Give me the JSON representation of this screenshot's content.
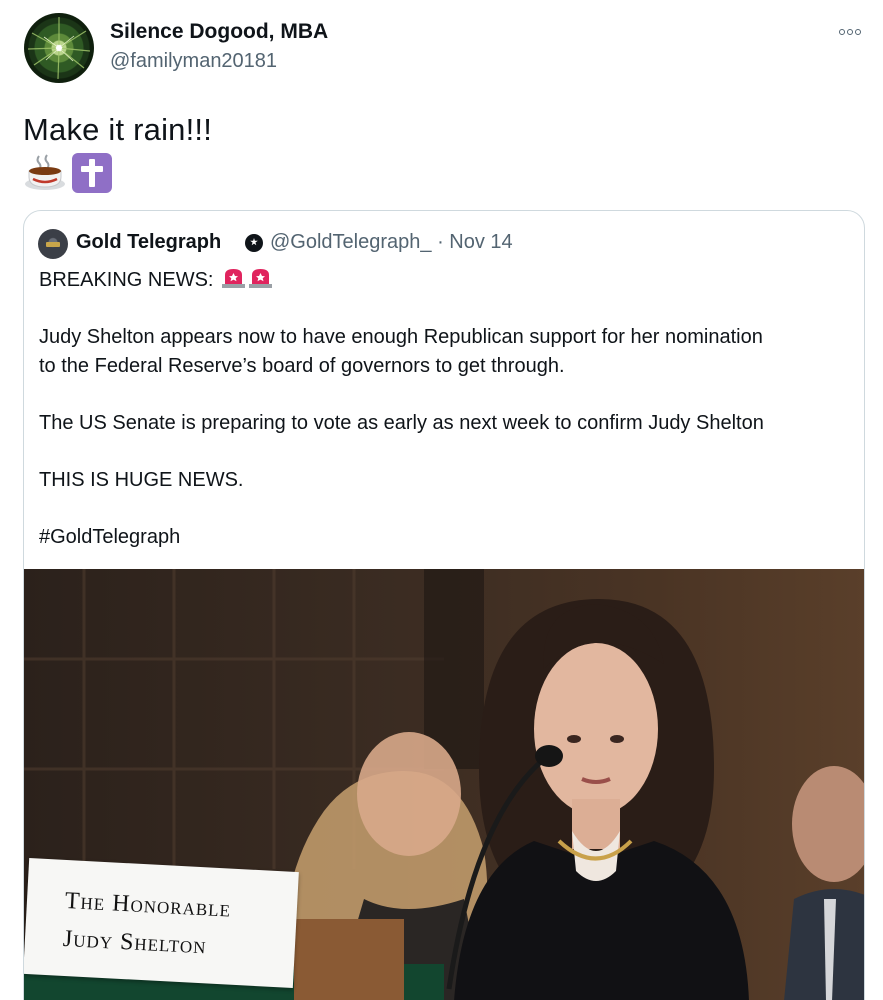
{
  "author": {
    "display_name": "Silence Dogood, MBA",
    "handle": "@familyman20181"
  },
  "tweet": {
    "text": "Make it rain!!!",
    "emojis": [
      "coffee-icon",
      "latin-cross-icon"
    ]
  },
  "quoted_tweet": {
    "author_name": "Gold Telegraph",
    "handle_date": "@GoldTelegraph_ · Nov 14",
    "lines": {
      "l1": "BREAKING NEWS:",
      "l2": "Judy Shelton appears now to have enough Republican support for her nomination",
      "l3": "to the Federal Reserve’s board of governors to get through.",
      "l4": "The US Senate is preparing to vote as early as next week to confirm Judy Shelton",
      "l5": "THIS IS HUGE NEWS.",
      "l6": "#GoldTelegraph"
    },
    "image": {
      "placard_line1": "The Honorable",
      "placard_line2": "Judy Shelton"
    }
  },
  "colors": {
    "text_primary": "#0f1419",
    "text_secondary": "#536471",
    "border": "#cfd9de"
  }
}
